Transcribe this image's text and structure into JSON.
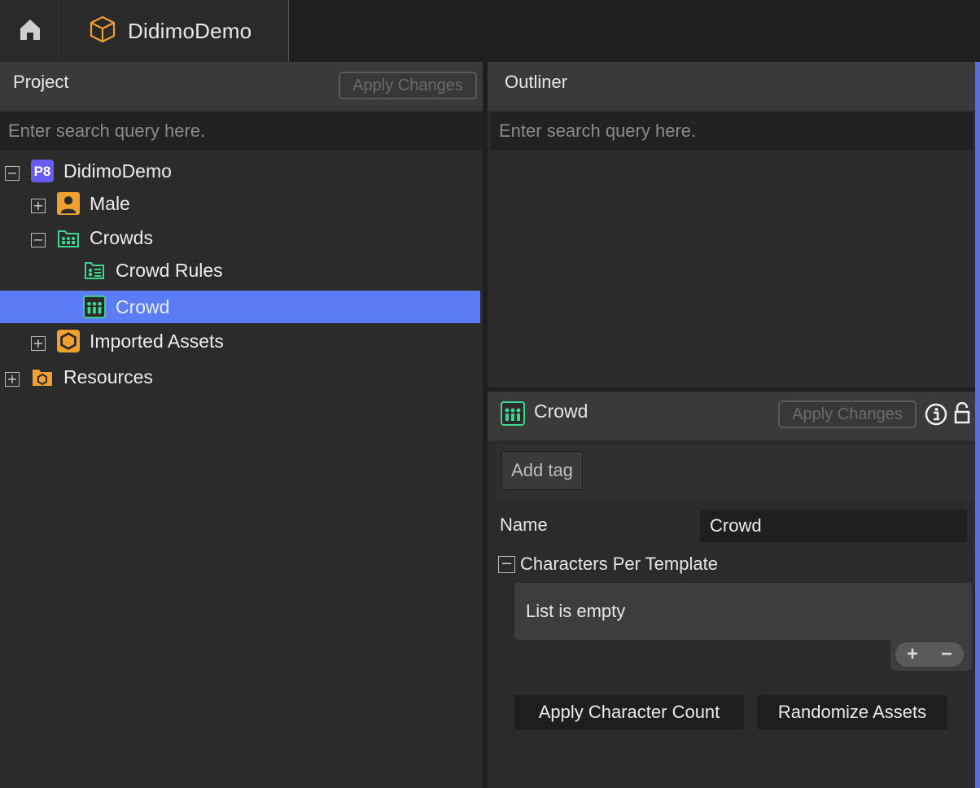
{
  "tabs": {
    "home_icon": "home-icon",
    "document": {
      "icon": "cube-icon",
      "label": "DidimoDemo"
    }
  },
  "project_panel": {
    "title": "Project",
    "apply_changes": "Apply Changes",
    "search_placeholder": "Enter search query here.",
    "tree": [
      {
        "label": "DidimoDemo",
        "icon": "project-p8-icon",
        "badge": "P8",
        "expander": "−",
        "depth": 0
      },
      {
        "label": "Male",
        "icon": "person-icon",
        "expander": "+",
        "depth": 1
      },
      {
        "label": "Crowds",
        "icon": "crowd-folder-icon",
        "expander": "−",
        "depth": 1
      },
      {
        "label": "Crowd Rules",
        "icon": "crowd-rules-icon",
        "expander": "",
        "depth": 2
      },
      {
        "label": "Crowd",
        "icon": "crowd-icon",
        "expander": "",
        "depth": 2,
        "selected": true
      },
      {
        "label": "Imported Assets",
        "icon": "hexagon-icon",
        "expander": "+",
        "depth": 1
      },
      {
        "label": "Resources",
        "icon": "resource-folder-icon",
        "expander": "+",
        "depth": 0
      }
    ]
  },
  "outliner_panel": {
    "title": "Outliner",
    "search_placeholder": "Enter search query here."
  },
  "inspector": {
    "title": "Crowd",
    "icon": "crowd-icon",
    "apply_changes": "Apply Changes",
    "info_icon": "info-icon",
    "lock_icon": "unlock-icon",
    "add_tag": "Add tag",
    "name_label": "Name",
    "name_value": "Crowd",
    "section_label": "Characters Per Template",
    "section_expander": "−",
    "list_empty": "List is empty",
    "add_symbol": "+",
    "remove_symbol": "−",
    "apply_character_count": "Apply Character Count",
    "randomize_assets": "Randomize Assets"
  },
  "colors": {
    "selection": "#5b7cf5",
    "accent_orange": "#f0a030",
    "accent_green": "#3dd68c",
    "accent_purple": "#7a5cff"
  }
}
